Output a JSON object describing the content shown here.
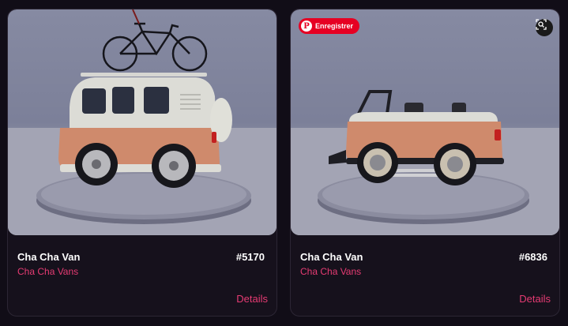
{
  "cards": [
    {
      "name": "Cha Cha Van",
      "token": "#5170",
      "collection": "Cha Cha Vans",
      "details_label": "Details",
      "image_alt": "van-with-bicycle"
    },
    {
      "name": "Cha Cha Van",
      "token": "#6836",
      "collection": "Cha Cha Vans",
      "details_label": "Details",
      "image_alt": "convertible-van",
      "pin_label": "Enregistrer",
      "pin_icon": "pinterest-icon",
      "lens_icon": "visual-search-icon"
    }
  ],
  "colors": {
    "accent": "#e63b73",
    "pinterest": "#e60023",
    "background": "#110d17",
    "card": "#16111c"
  }
}
